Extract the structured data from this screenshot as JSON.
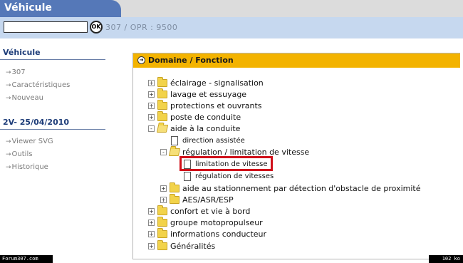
{
  "header": {
    "title": "Véhicule",
    "ok_label": "OK",
    "search_value": "",
    "breadcrumb": "307  /  OPR : 9500"
  },
  "sidebar": {
    "section1_title": "Véhicule",
    "section1_items": [
      "307",
      "Caractéristiques",
      "Nouveau"
    ],
    "section2_title": "2V- 25/04/2010",
    "section2_items": [
      "Viewer SVG",
      "Outils",
      "Historique"
    ]
  },
  "panel": {
    "title": "Domaine  /  Fonction",
    "tree": [
      {
        "label": "éclairage - signalisation",
        "type": "folder",
        "toggle": "+"
      },
      {
        "label": "lavage et essuyage",
        "type": "folder",
        "toggle": "+"
      },
      {
        "label": "protections et ouvrants",
        "type": "folder",
        "toggle": "+"
      },
      {
        "label": "poste de conduite",
        "type": "folder",
        "toggle": "+"
      },
      {
        "label": "aide à la conduite",
        "type": "folder-open",
        "toggle": "-"
      },
      {
        "label": "direction assistée",
        "type": "doc"
      },
      {
        "label": "régulation / limitation de vitesse",
        "type": "folder-open",
        "toggle": "-"
      },
      {
        "label": "limitation de vitesse",
        "type": "doc",
        "highlighted": true
      },
      {
        "label": "régulation de vitesses",
        "type": "doc"
      },
      {
        "label": "aide au stationnement par détection d'obstacle de proximité",
        "type": "folder",
        "toggle": "+"
      },
      {
        "label": "AES/ASR/ESP",
        "type": "folder",
        "toggle": "+"
      },
      {
        "label": "confort et vie à bord",
        "type": "folder",
        "toggle": "+"
      },
      {
        "label": "groupe motopropulseur",
        "type": "folder",
        "toggle": "+"
      },
      {
        "label": "informations conducteur",
        "type": "folder",
        "toggle": "+"
      },
      {
        "label": "Généralités",
        "type": "folder",
        "toggle": "+"
      }
    ]
  },
  "footer": {
    "left": "Forum307.com",
    "right": "102 ko"
  },
  "colors": {
    "header_tab": "#5578b8",
    "subheader": "#c6d8ef",
    "panel_header": "#f3b300",
    "highlight": "#d0101a"
  }
}
